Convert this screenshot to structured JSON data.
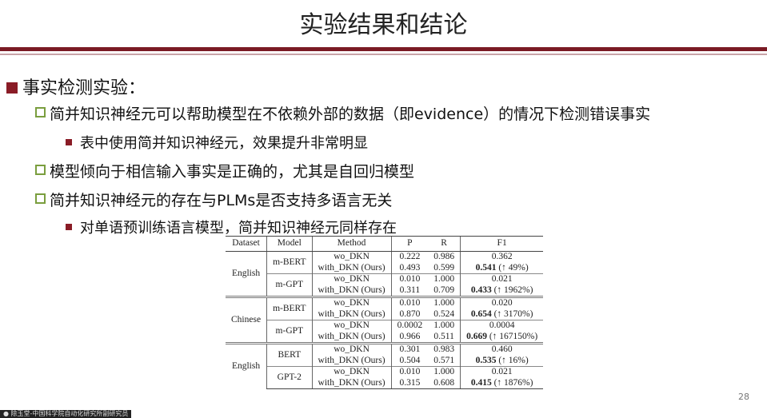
{
  "title": "实验结果和结论",
  "bullets": {
    "main": "事实检测实验：",
    "b1": "简并知识神经元可以帮助模型在不依赖外部的数据（即evidence）的情况下检测错误事实",
    "b1_sub": "表中使用简并知识神经元，效果提升非常明显",
    "b2": "模型倾向于相信输入事实是正确的，尤其是自回归模型",
    "b3": "简并知识神经元的存在与PLMs是否支持多语言无关",
    "b3_sub": "对单语预训练语言模型，简并知识神经元同样存在"
  },
  "table": {
    "headers": [
      "Dataset",
      "Model",
      "Method",
      "P",
      "R",
      "F1"
    ],
    "groups": [
      {
        "dataset": "English",
        "models": [
          {
            "model": "m-BERT",
            "methods": [
              "wo_DKN",
              "with_DKN (Ours)"
            ],
            "p": [
              "0.222",
              "0.493"
            ],
            "r": [
              "0.986",
              "0.599"
            ],
            "f1a": "0.362",
            "f1b": "0.541",
            "f1b_gain": "(↑ 49%)"
          },
          {
            "model": "m-GPT",
            "methods": [
              "wo_DKN",
              "with_DKN (Ours)"
            ],
            "p": [
              "0.010",
              "0.311"
            ],
            "r": [
              "1.000",
              "0.709"
            ],
            "f1a": "0.021",
            "f1b": "0.433",
            "f1b_gain": "(↑ 1962%)"
          }
        ]
      },
      {
        "dataset": "Chinese",
        "models": [
          {
            "model": "m-BERT",
            "methods": [
              "wo_DKN",
              "with_DKN (Ours)"
            ],
            "p": [
              "0.010",
              "0.870"
            ],
            "r": [
              "1.000",
              "0.524"
            ],
            "f1a": "0.020",
            "f1b": "0.654",
            "f1b_gain": "(↑ 3170%)"
          },
          {
            "model": "m-GPT",
            "methods": [
              "wo_DKN",
              "with_DKN (Ours)"
            ],
            "p": [
              "0.0002",
              "0.966"
            ],
            "r": [
              "1.000",
              "0.511"
            ],
            "f1a": "0.0004",
            "f1b": "0.669",
            "f1b_gain": "(↑ 167150%)"
          }
        ]
      },
      {
        "dataset": "English",
        "models": [
          {
            "model": "BERT",
            "methods": [
              "wo_DKN",
              "with_DKN (Ours)"
            ],
            "p": [
              "0.301",
              "0.504"
            ],
            "r": [
              "0.983",
              "0.571"
            ],
            "f1a": "0.460",
            "f1b": "0.535",
            "f1b_gain": "(↑ 16%)"
          },
          {
            "model": "GPT-2",
            "methods": [
              "wo_DKN",
              "with_DKN (Ours)"
            ],
            "p": [
              "0.010",
              "0.315"
            ],
            "r": [
              "1.000",
              "0.608"
            ],
            "f1a": "0.021",
            "f1b": "0.415",
            "f1b_gain": "(↑ 1876%)"
          }
        ]
      }
    ]
  },
  "page_number": "28",
  "footer_tag": "● 除玉堂-中国科学院自动化研究所副研究员"
}
